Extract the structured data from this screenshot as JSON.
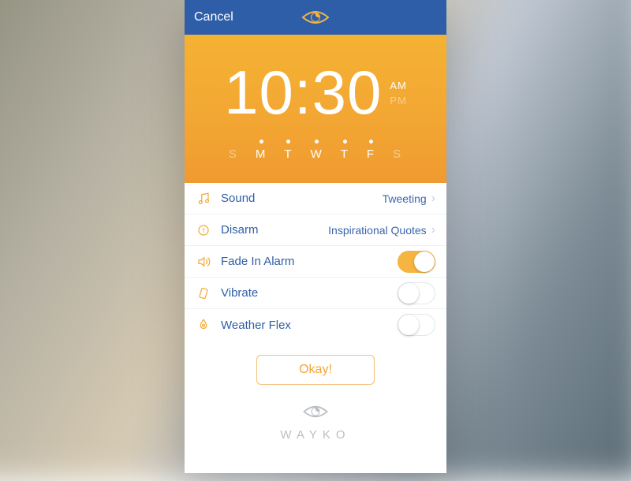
{
  "nav": {
    "cancel": "Cancel"
  },
  "alarm": {
    "time": "10:30",
    "am": "AM",
    "pm": "PM",
    "meridiem_selected": "AM",
    "days": [
      {
        "letter": "S",
        "active": false
      },
      {
        "letter": "M",
        "active": true
      },
      {
        "letter": "T",
        "active": true
      },
      {
        "letter": "W",
        "active": true
      },
      {
        "letter": "T",
        "active": true
      },
      {
        "letter": "F",
        "active": true
      },
      {
        "letter": "S",
        "active": false
      }
    ]
  },
  "settings": {
    "sound": {
      "label": "Sound",
      "value": "Tweeting"
    },
    "disarm": {
      "label": "Disarm",
      "value": "Inspirational Quotes"
    },
    "fade": {
      "label": "Fade In Alarm",
      "on": true
    },
    "vibrate": {
      "label": "Vibrate",
      "on": false
    },
    "weather": {
      "label": "Weather Flex",
      "on": false
    }
  },
  "actions": {
    "okay": "Okay!"
  },
  "brand": {
    "name": "WAYKO"
  },
  "colors": {
    "accent": "#f3a733",
    "navbar": "#2f5ea8",
    "text": "#2f5ea8"
  }
}
